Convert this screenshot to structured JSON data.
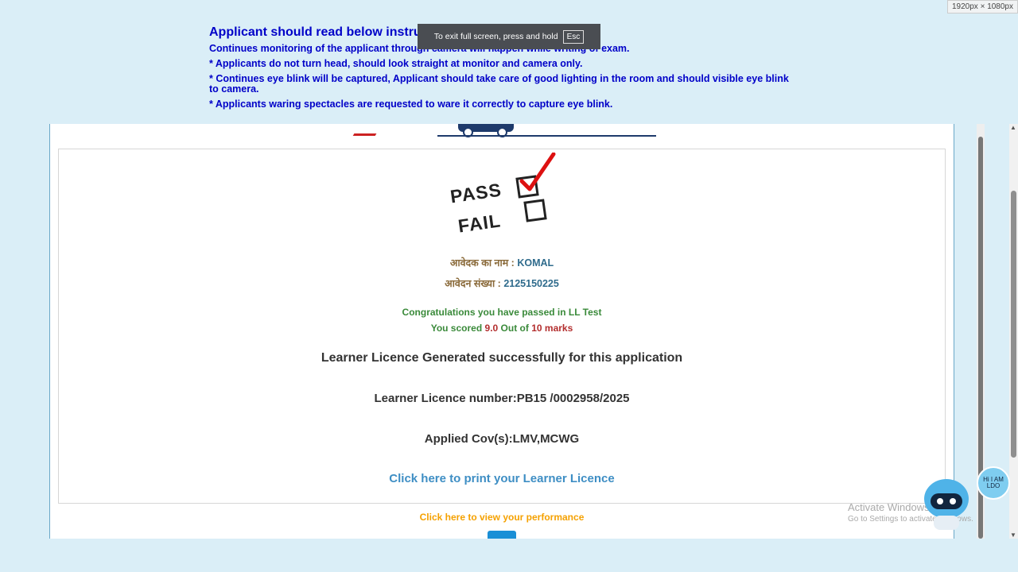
{
  "instructions": {
    "title": "Applicant should read below instructions",
    "lines": [
      "Continues monitoring of the applicant through camera will happen while writing of exam.",
      "* Applicants do not turn head, should look straight at monitor and camera only.",
      "* Continues eye blink will be captured, Applicant should take care of good lighting in the room and should visible eye blink to camera.",
      "* Applicants waring spectacles are requested to ware it correctly to capture eye blink."
    ]
  },
  "fullscreen_toast": {
    "text": "To exit full screen, press and hold",
    "key": "Esc"
  },
  "dimension_badge": "1920px × 1080px",
  "result": {
    "pass_label": "PASS",
    "fail_label": "FAIL",
    "name_label": "आवेदक का नाम :",
    "name_value": "KOMAL",
    "appno_label": "आवेदन संख्या :",
    "appno_value": "2125150225",
    "congrats": "Congratulations you have passed in LL Test",
    "score_prefix": "You scored",
    "score_value": "9.0",
    "score_mid": "Out of",
    "score_total": "10",
    "score_suffix": "marks",
    "generated": "Learner Licence Generated successfully for this application",
    "ll_number": "Learner Licence number:PB15 /0002958/2025",
    "cov": "Applied Cov(s):LMV,MCWG",
    "print_link": "Click here to print your Learner Licence",
    "performance_link": "Click here to view your performance"
  },
  "windows_watermark": {
    "line1": "Activate Windows",
    "line2": "Go to Settings to activate Windows."
  },
  "chatbot": {
    "bubble_text": "Hi I AM LDO"
  },
  "colors": {
    "page_bg": "#daeef7",
    "instruction_text": "#0000c8",
    "success_green": "#3a8a3a",
    "score_red": "#b32e2e",
    "link_blue": "#3e8ec4",
    "perf_orange": "#f5a100"
  }
}
